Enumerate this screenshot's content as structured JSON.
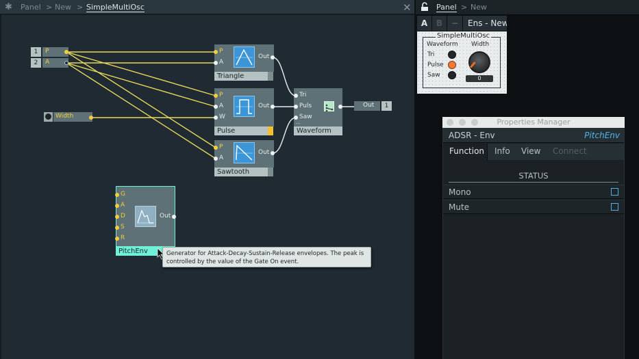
{
  "editor": {
    "breadcrumb": [
      "Panel",
      "New",
      "SimpleMultiOsc"
    ],
    "separator": ">",
    "close_glyph": "✕",
    "app_icon": "bug-icon"
  },
  "inputs": [
    {
      "index": "1",
      "label": "P"
    },
    {
      "index": "2",
      "label": "A"
    }
  ],
  "width_knob": {
    "label": "Width"
  },
  "modules": {
    "triangle": {
      "label": "Triangle",
      "ports": [
        "P",
        "A"
      ],
      "out": "Out"
    },
    "pulse": {
      "label": "Pulse",
      "ports": [
        "P",
        "A",
        "W"
      ],
      "out": "Out"
    },
    "sawtooth": {
      "label": "Sawtooth",
      "ports": [
        "P",
        "A"
      ],
      "out": "Out"
    },
    "waveform": {
      "label": "Waveform",
      "ports": [
        "Tri",
        "Puls",
        "Saw"
      ],
      "more": "..."
    },
    "output": {
      "label": "Out",
      "index": "1"
    },
    "pitchenv": {
      "label": "PitchEnv",
      "ports": [
        "G",
        "A",
        "D",
        "S",
        "R"
      ],
      "out": "Out"
    }
  },
  "tooltip": {
    "line1": "Generator for Attack-Decay-Sustain-Release envelopes. The peak is",
    "line2": "controlled by the value of the Gate On event."
  },
  "panel": {
    "breadcrumb": [
      "Panel",
      "New"
    ],
    "separator": ">",
    "lock_icon": "unlock-icon",
    "toolbar": {
      "a": "A",
      "b": "B",
      "minus": "−",
      "ensemble": "Ens - New"
    },
    "ensemble": {
      "title": "SimpleMultiOsc",
      "waveform_label": "Waveform",
      "width_label": "Width",
      "options": [
        {
          "label": "Tri",
          "on": false
        },
        {
          "label": "Pulse",
          "on": true
        },
        {
          "label": "Saw",
          "on": false
        }
      ],
      "width_value": "0"
    }
  },
  "properties_manager": {
    "title": "Properties Manager",
    "module_type": "ADSR - Env",
    "module_name": "PitchEnv",
    "tabs": [
      {
        "label": "Function",
        "state": "active"
      },
      {
        "label": "Info",
        "state": "normal"
      },
      {
        "label": "View",
        "state": "normal"
      },
      {
        "label": "Connect",
        "state": "disabled"
      }
    ],
    "section": "STATUS",
    "rows": [
      {
        "label": "Mono",
        "checked": false
      },
      {
        "label": "Mute",
        "checked": false
      }
    ]
  },
  "colors": {
    "wire_yellow": "#e8d85a",
    "wire_white": "#e6ecee",
    "accent_blue": "#4fb3e9",
    "selected_cyan": "#6ff0d8",
    "led_on": "#f37a34"
  }
}
